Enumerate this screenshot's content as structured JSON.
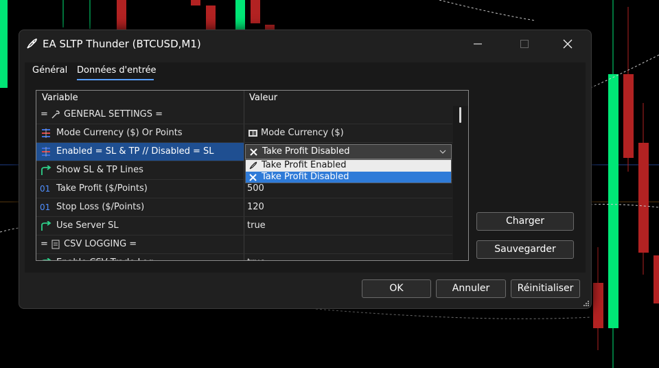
{
  "window": {
    "title": "EA SLTP Thunder (BTCUSD,M1)",
    "minimize_icon": "minimize-icon",
    "maximize_icon": "maximize-icon",
    "close_icon": "close-icon"
  },
  "tabs": [
    {
      "label": "Général",
      "active": false
    },
    {
      "label": "Données d'entrée",
      "active": true
    }
  ],
  "grid": {
    "headers": {
      "variable": "Variable",
      "value": "Valeur"
    },
    "rows": [
      {
        "prefix": "=",
        "icon": "wrench-icon",
        "variable": "GENERAL SETTINGS =",
        "value": ""
      },
      {
        "icon": "enum-icon",
        "variable": "Mode Currency ($) Or Points",
        "value_icon": "currency-icon",
        "value": "Mode Currency ($)"
      },
      {
        "icon": "enum-icon",
        "variable": "Enabled = SL & TP // Disabled = SL",
        "value_icon": "x-icon",
        "value": "Take Profit Disabled",
        "selected": true
      },
      {
        "icon": "bool-icon",
        "variable": "Show SL & TP Lines",
        "value": ""
      },
      {
        "icon": "int-icon",
        "variable": "Take Profit ($/Points)",
        "value": "500"
      },
      {
        "icon": "int-icon",
        "variable": "Stop Loss ($/Points)",
        "value": "120"
      },
      {
        "icon": "bool-icon",
        "variable": "Use Server SL",
        "value": "true"
      },
      {
        "prefix": "=",
        "icon": "document-icon",
        "variable": "CSV LOGGING =",
        "value": ""
      },
      {
        "icon": "bool-icon",
        "variable": "Enable CSV Trade Log",
        "value": "true"
      }
    ]
  },
  "dropdown": {
    "options": [
      {
        "icon": "rocket-icon",
        "label": "Take Profit Enabled"
      },
      {
        "icon": "x-icon",
        "label": "Take Profit Disabled",
        "selected": true
      }
    ]
  },
  "side_buttons": {
    "load": "Charger",
    "save": "Sauvegarder"
  },
  "footer_buttons": {
    "ok": "OK",
    "cancel": "Annuler",
    "reset": "Réinitialiser"
  },
  "colors": {
    "accent": "#5aa0ff",
    "selection": "#1f4f91",
    "dropdown_selection": "#2f7bd8",
    "bull": "#00e676",
    "bear": "#b22222"
  }
}
